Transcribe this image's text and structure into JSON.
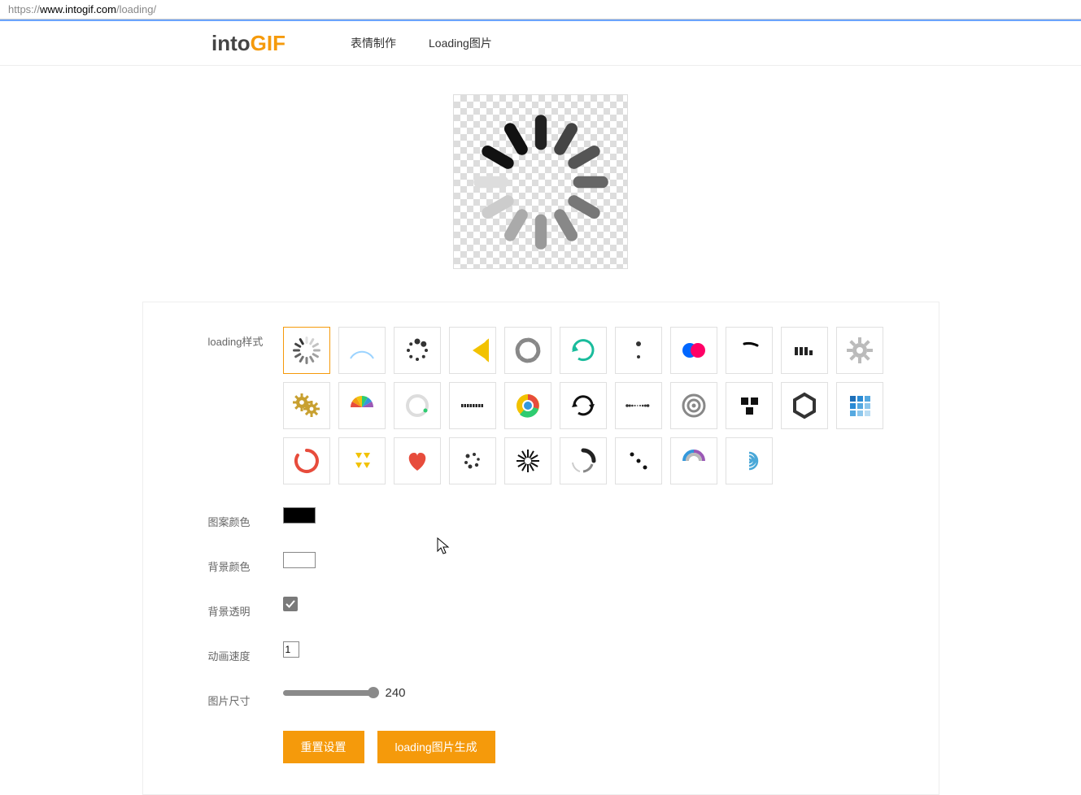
{
  "url": {
    "protocol": "https://",
    "host": "www.intogif.com",
    "path": "/loading/"
  },
  "logo": {
    "part1": "into",
    "part2": "GIF"
  },
  "nav": {
    "item1": "表情制作",
    "item2": "Loading图片"
  },
  "labels": {
    "style": "loading样式",
    "fgcolor": "图案颜色",
    "bgcolor": "背景颜色",
    "transparent": "背景透明",
    "speed": "动画速度",
    "size": "图片尺寸"
  },
  "values": {
    "fgcolor": "#000000",
    "bgcolor": "#ffffff",
    "transparent": true,
    "speed": "1",
    "size": "240"
  },
  "buttons": {
    "reset": "重置设置",
    "generate": "loading图片生成"
  },
  "styles": {
    "selected_index": 0,
    "items": [
      "spinner",
      "arc",
      "dots-circle",
      "pacman",
      "dashed-ring",
      "refresh-arrow",
      "two-dots",
      "dual-circles",
      "boomerang",
      "equalizer",
      "gear",
      "two-gears",
      "rainbow-gauge",
      "ring-glow",
      "bar-segments",
      "chrome",
      "cycle-arrows",
      "dot-wave",
      "target",
      "tetromino",
      "hexagon",
      "grid-squares",
      "open-ring",
      "triangles",
      "heart",
      "dot-cluster",
      "asterisk",
      "comet",
      "three-dots-diag",
      "rainbow-swirl",
      "spiral"
    ]
  }
}
